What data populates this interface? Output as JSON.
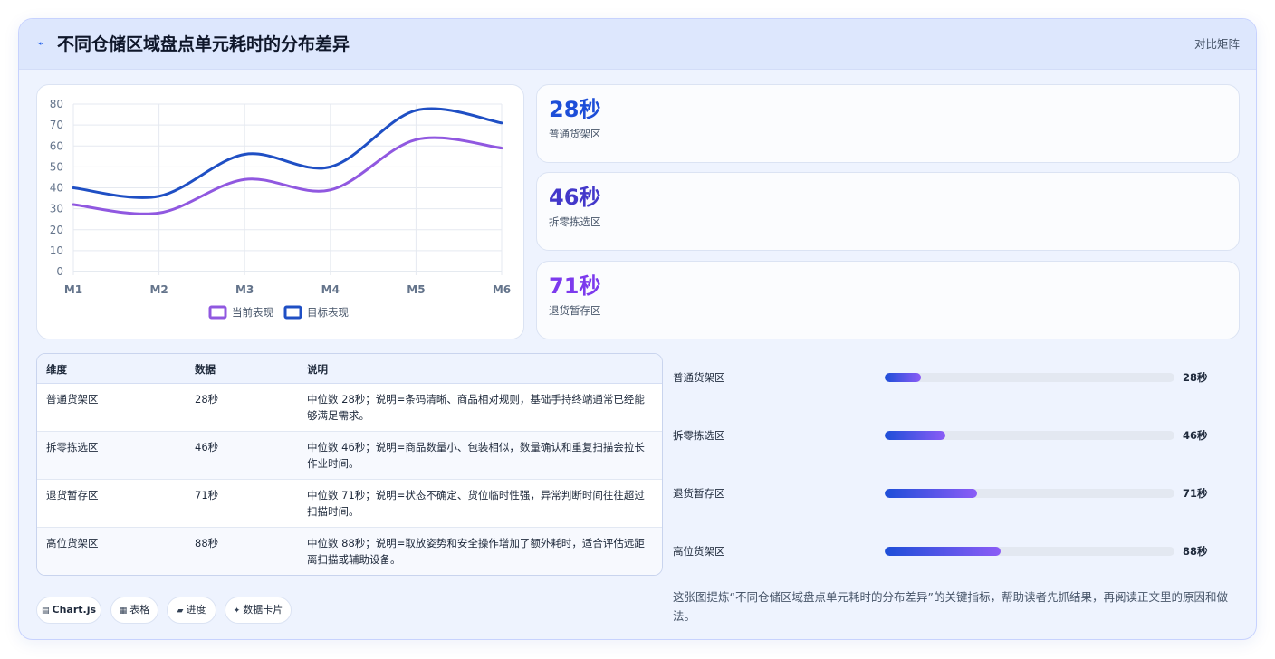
{
  "header": {
    "icon": "trend-icon",
    "title": "不同仓储区域盘点单元耗时的分布差异",
    "right_label": "对比矩阵"
  },
  "chart_data": {
    "type": "line",
    "categories": [
      "M1",
      "M2",
      "M3",
      "M4",
      "M5",
      "M6"
    ],
    "series": [
      {
        "name": "当前表现",
        "values": [
          32,
          28,
          44,
          39,
          63,
          59
        ],
        "color": "#9058e0"
      },
      {
        "name": "目标表现",
        "values": [
          40,
          36,
          56,
          50,
          77,
          71
        ],
        "color": "#1f4fc4"
      }
    ],
    "ylim": [
      0,
      80
    ],
    "yticks": [
      0,
      10,
      20,
      30,
      40,
      50,
      60,
      70,
      80
    ],
    "grid": true,
    "legend": "bottom",
    "smooth": true
  },
  "stats": [
    {
      "value": "28秒",
      "label": "普通货架区",
      "color": "#1d4ed8"
    },
    {
      "value": "46秒",
      "label": "拆零拣选区",
      "color": "#4338ca"
    },
    {
      "value": "71秒",
      "label": "退货暂存区",
      "color": "#7c3aed"
    }
  ],
  "table": {
    "headers": [
      "维度",
      "数据",
      "说明"
    ],
    "rows": [
      [
        "普通货架区",
        "28秒",
        "中位数 28秒；说明=条码清晰、商品相对规则，基础手持终端通常已经能够满足需求。"
      ],
      [
        "拆零拣选区",
        "46秒",
        "中位数 46秒；说明=商品数量小、包装相似，数量确认和重复扫描会拉长作业时间。"
      ],
      [
        "退货暂存区",
        "71秒",
        "中位数 71秒；说明=状态不确定、货位临时性强，异常判断时间往往超过扫描时间。"
      ],
      [
        "高位货架区",
        "88秒",
        "中位数 88秒；说明=取放姿势和安全操作增加了额外耗时，适合评估远距离扫描或辅助设备。"
      ]
    ]
  },
  "progress": [
    {
      "label": "普通货架区",
      "value": "28秒",
      "fraction": 0.125
    },
    {
      "label": "拆零拣选区",
      "value": "46秒",
      "fraction": 0.21
    },
    {
      "label": "退货暂存区",
      "value": "71秒",
      "fraction": 0.32
    },
    {
      "label": "高位货架区",
      "value": "88秒",
      "fraction": 0.4
    }
  ],
  "chips": [
    {
      "icon": "chart-icon",
      "glyph": "▤",
      "label": "Chart.js"
    },
    {
      "icon": "table-icon",
      "glyph": "▦",
      "label": "表格"
    },
    {
      "icon": "progress-icon",
      "glyph": "▰",
      "label": "进度"
    },
    {
      "icon": "sparkle-icon",
      "glyph": "✦",
      "label": "数据卡片"
    }
  ],
  "footer_note": "这张图提炼“不同仓储区域盘点单元耗时的分布差异”的关键指标，帮助读者先抓结果，再阅读正文里的原因和做法。"
}
